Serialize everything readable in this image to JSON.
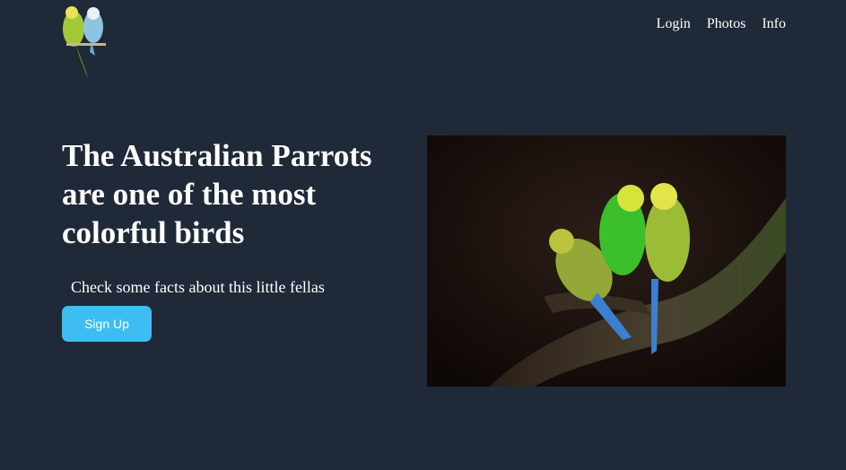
{
  "logo": {
    "icon": "budgies-logo-icon"
  },
  "nav": {
    "items": [
      "Login",
      "Photos",
      "Info"
    ]
  },
  "hero": {
    "title": "The Australian Parrots are one of the most colorful birds",
    "subtitle": "Check some facts about this little fellas",
    "cta": "Sign Up"
  },
  "image": {
    "icon": "parrots-photo"
  },
  "colors": {
    "background": "#1f2937",
    "accent": "#3dbdf2",
    "text": "#ffffff"
  }
}
